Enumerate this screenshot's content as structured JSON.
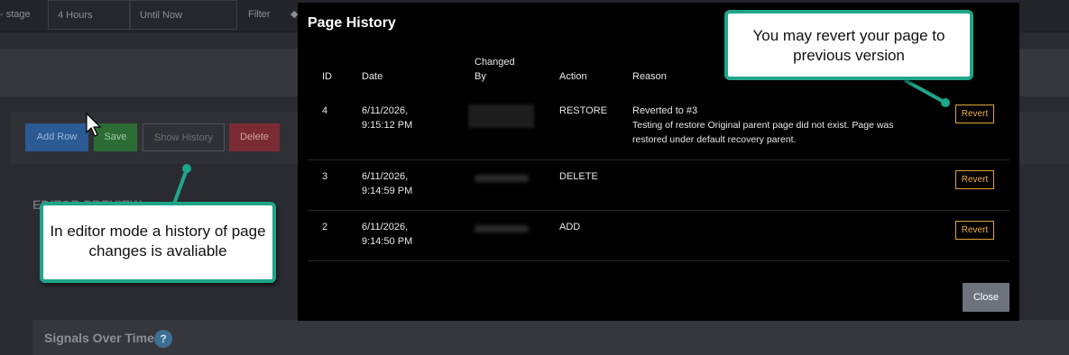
{
  "background": {
    "topbar": {
      "stage_label": "- stage",
      "time_range": "4 Hours",
      "until": "Until Now",
      "filter_label": "Filter",
      "filter_icon": "◆"
    },
    "toolbar": {
      "add_row": "Add Row",
      "save": "Save",
      "show_history": "Show History",
      "delete": "Delete"
    },
    "editor_heading": "EDITOR PREVIEW",
    "signals_title": "Signals Over Time",
    "help_icon": "?"
  },
  "modal": {
    "title": "Page History",
    "columns": {
      "id": "ID",
      "date": "Date",
      "changed_by": "Changed By",
      "action": "Action",
      "reason": "Reason"
    },
    "rows": [
      {
        "id": "4",
        "date_line1": "6/11/2026,",
        "date_line2": "9:15:12 PM",
        "action": "RESTORE",
        "reason_title": "Reverted to #3",
        "reason_detail": "Testing of restore Original parent page did not exist. Page was restored under default recovery parent.",
        "revert": "Revert"
      },
      {
        "id": "3",
        "date_line1": "6/11/2026,",
        "date_line2": "9:14:59 PM",
        "action": "DELETE",
        "reason_title": "",
        "reason_detail": "",
        "revert": "Revert"
      },
      {
        "id": "2",
        "date_line1": "6/11/2026,",
        "date_line2": "9:14:50 PM",
        "action": "ADD",
        "reason_title": "",
        "reason_detail": "",
        "revert": "Revert"
      }
    ],
    "close": "Close"
  },
  "callouts": {
    "editor_note": "In editor mode a history of page changes is avaliable",
    "revert_note": "You may revert your page to previous version"
  },
  "colors": {
    "modal_bg": "#000000",
    "revert_border": "#e0a538",
    "callout_border": "#1fa58a",
    "close_bg": "#6c737b"
  }
}
